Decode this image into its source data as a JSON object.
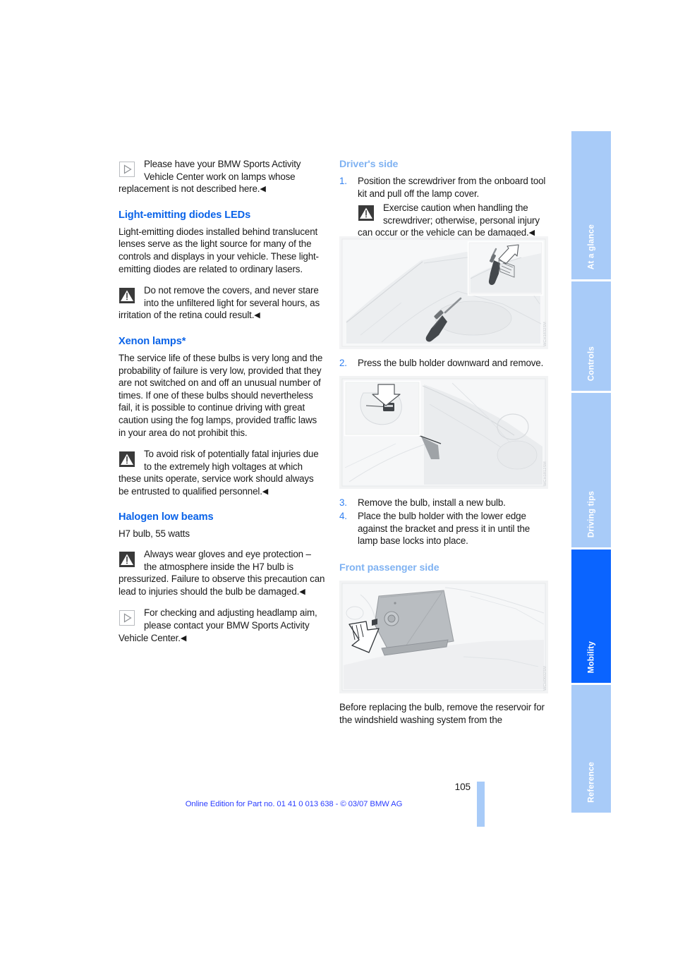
{
  "document": {
    "page_number": "105",
    "footer_note": "Online Edition for Part no. 01 41 0 013 638 - © 03/07 BMW AG"
  },
  "left_column": {
    "intro_note": {
      "icon": "note-triangle-outline-icon",
      "text": "Please have your BMW Sports Activity Vehicle Center work on lamps whose replacement is not described here.",
      "endmark": "◀"
    },
    "leds": {
      "heading": "Light-emitting diodes LEDs",
      "body": "Light-emitting diodes installed behind translucent lenses serve as the light source for many of the controls and displays in your vehicle. These light-emitting diodes are related to ordinary lasers.",
      "warning": {
        "icon": "warning-triangle-icon",
        "text": "Do not remove the covers, and never stare into the unfiltered light for several hours, as irritation of the retina could result.",
        "endmark": "◀"
      }
    },
    "xenon": {
      "heading": "Xenon lamps*",
      "body": "The service life of these bulbs is very long and the probability of failure is very low, provided that they are not switched on and off an unusual number of times. If one of these bulbs should nevertheless fail, it is possible to continue driving with great caution using the fog lamps, provided traffic laws in your area do not prohibit this.",
      "warning": {
        "icon": "warning-triangle-icon",
        "text": "To avoid risk of potentially fatal injuries due to the extremely high voltages at which these units operate, service work should always be entrusted to qualified personnel.",
        "endmark": "◀"
      }
    },
    "halogen": {
      "heading": "Halogen low beams",
      "spec": "H7 bulb, 55 watts",
      "warning": {
        "icon": "warning-triangle-icon",
        "text": "Always wear gloves and eye protection – the atmosphere inside the H7 bulb is pressurized. Failure to observe this precaution can lead to injuries should the bulb be damaged.",
        "endmark": "◀"
      },
      "note": {
        "icon": "note-triangle-outline-icon",
        "text": "For checking and adjusting headlamp aim, please contact your BMW Sports Activity Vehicle Center.",
        "endmark": "◀"
      }
    }
  },
  "right_column": {
    "drivers_side": {
      "heading": "Driver's side",
      "steps": [
        {
          "num": "1.",
          "text": "Position the screwdriver from the onboard tool kit and pull off the lamp cover."
        },
        {
          "num": "2.",
          "text": "Press the bulb holder downward and remove."
        },
        {
          "num": "3.",
          "text": "Remove the bulb, install a new bulb."
        },
        {
          "num": "4.",
          "text": "Place the bulb holder with the lower edge against the bracket and press it in until the lamp base locks into place."
        }
      ],
      "step1_warning": {
        "icon": "warning-triangle-icon",
        "text": "Exercise caution when handling the screwdriver; otherwise, personal injury can occur or the vehicle can be damaged.",
        "endmark": "◀"
      },
      "figure1_caption": "headlamp-cover-screwdriver-illustration",
      "figure1_watermark": "WCH1832SM",
      "figure2_caption": "bulb-holder-press-down-illustration",
      "figure2_watermark": "WCH1812SM"
    },
    "front_passenger_side": {
      "heading": "Front passenger side",
      "figure3_caption": "washer-reservoir-removal-illustration",
      "figure3_watermark": "WCH0602SM",
      "body": "Before replacing the bulb, remove the reservoir for the windshield washing system from the"
    }
  },
  "tab_rail": {
    "tabs": [
      {
        "label": "At a glance",
        "active": false
      },
      {
        "label": "Controls",
        "active": false
      },
      {
        "label": "Driving tips",
        "active": false
      },
      {
        "label": "Mobility",
        "active": true
      },
      {
        "label": "Reference",
        "active": false
      }
    ],
    "active_color": "#0a64ff",
    "inactive_color": "#a8cbf8"
  },
  "colors": {
    "heading_blue": "#0a63e8",
    "subheading_blue": "#7fb2f2",
    "footer_blue": "#2b3dff"
  }
}
